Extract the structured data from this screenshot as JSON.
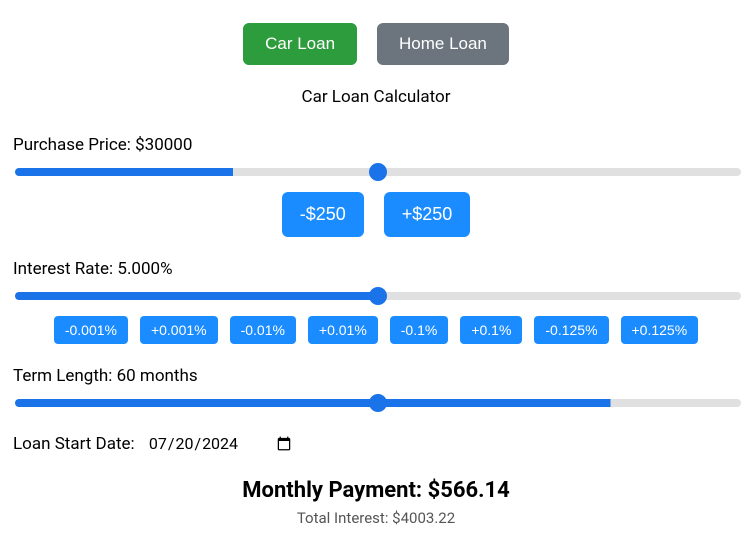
{
  "tabs": {
    "car": "Car Loan",
    "home": "Home Loan",
    "active": "car"
  },
  "title": "Car Loan Calculator",
  "purchase": {
    "label_prefix": "Purchase Price: $",
    "value": "30000",
    "slider_fill": "30%",
    "dec_label": "-$250",
    "inc_label": "+$250"
  },
  "interest": {
    "label_prefix": "Interest Rate: ",
    "value": "5.000",
    "suffix": "%",
    "slider_fill": "49.5%",
    "steps": [
      "-0.001%",
      "+0.001%",
      "-0.01%",
      "+0.01%",
      "-0.1%",
      "+0.1%",
      "-0.125%",
      "+0.125%"
    ]
  },
  "term": {
    "label_prefix": "Term Length: ",
    "value": "60",
    "suffix": " months",
    "slider_fill": "82%"
  },
  "loan_date": {
    "label": "Loan Start Date: ",
    "value": "2024-07-20"
  },
  "results": {
    "monthly_label": "Monthly Payment: $",
    "monthly_value": "566.14",
    "total_interest_label": "Total Interest: $",
    "total_interest_value": "4003.22"
  }
}
